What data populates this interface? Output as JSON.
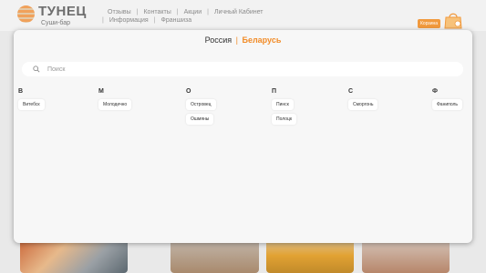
{
  "header": {
    "logo_name": "ТУНЕЦ",
    "logo_sub": "Суши-бар",
    "nav_row1": [
      "Отзывы",
      "Контакты",
      "Акции",
      "Личный Кабинет"
    ],
    "nav_row2": [
      "Информация",
      "Франшиза"
    ],
    "basket_label": "Корзина"
  },
  "modal": {
    "country_ru": "Россия",
    "country_sep": "|",
    "country_by": "Беларусь",
    "search_placeholder": "Поиск",
    "groups": [
      {
        "letter": "В",
        "cities": [
          "Витебск"
        ]
      },
      {
        "letter": "М",
        "cities": [
          "Молодечно"
        ]
      },
      {
        "letter": "О",
        "cities": [
          "Островец",
          "Ошмяны"
        ]
      },
      {
        "letter": "П",
        "cities": [
          "Пинск",
          "Полоцк"
        ]
      },
      {
        "letter": "С",
        "cities": [
          "Сморгонь"
        ]
      },
      {
        "letter": "Ф",
        "cities": [
          "Фаниполь"
        ]
      }
    ]
  },
  "colors": {
    "accent": "#f28c28",
    "modal_bg": "#f7f7f7"
  }
}
